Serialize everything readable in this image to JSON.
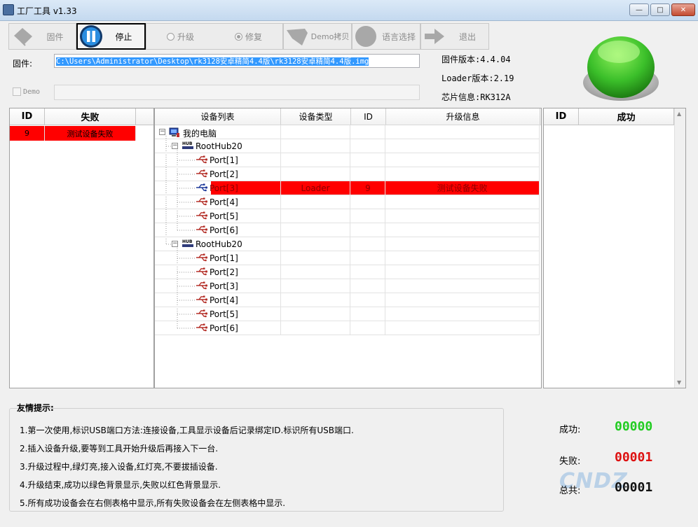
{
  "window": {
    "title": "工厂工具 v1.33",
    "buttons": [
      "minimize",
      "maximize",
      "close"
    ]
  },
  "toolbar": {
    "firmware_label": "固件",
    "stop_label": "停止",
    "upgrade_label": "升级",
    "repair_label": "修复",
    "demo_copy_label": "Demo拷贝",
    "language_label": "语言选择",
    "exit_label": "退出",
    "mode_selected": "修复"
  },
  "firmware": {
    "label": "固件:",
    "path": "C:\\Users\\Administrator\\Desktop\\rk3128安卓精简4.4版\\rk3128安卓精简4.4版.img"
  },
  "demo": {
    "label": "Demo",
    "checked": false,
    "value": ""
  },
  "info": {
    "fw_version": "固件版本:4.4.04",
    "loader_version": "Loader版本:2.19",
    "chip_info": "芯片信息:RK312A"
  },
  "status_light": {
    "color": "#2fb52f",
    "state": "green"
  },
  "fail_table": {
    "headers": [
      "ID",
      "失败"
    ],
    "rows": [
      {
        "id": "9",
        "msg": "测试设备失败"
      }
    ]
  },
  "success_table": {
    "headers": [
      "ID",
      "成功"
    ],
    "rows": []
  },
  "device_table": {
    "headers": [
      "设备列表",
      "设备类型",
      "ID",
      "升级信息"
    ],
    "tree": [
      {
        "label": "我的电脑",
        "icon": "computer-icon",
        "level": 0,
        "type": "",
        "id": "",
        "info": ""
      },
      {
        "label": "RootHub20",
        "icon": "hub-icon",
        "level": 1,
        "type": "",
        "id": "",
        "info": ""
      },
      {
        "label": "Port[1]",
        "icon": "usb-icon",
        "level": 2,
        "type": "",
        "id": "",
        "info": ""
      },
      {
        "label": "Port[2]",
        "icon": "usb-icon",
        "level": 2,
        "type": "",
        "id": "",
        "info": ""
      },
      {
        "label": "Port[3]",
        "icon": "usb-icon",
        "level": 2,
        "type": "Loader",
        "id": "9",
        "info": "测试设备失败",
        "failed": true
      },
      {
        "label": "Port[4]",
        "icon": "usb-icon",
        "level": 2,
        "type": "",
        "id": "",
        "info": ""
      },
      {
        "label": "Port[5]",
        "icon": "usb-icon",
        "level": 2,
        "type": "",
        "id": "",
        "info": ""
      },
      {
        "label": "Port[6]",
        "icon": "usb-icon",
        "level": 2,
        "type": "",
        "id": "",
        "info": ""
      },
      {
        "label": "RootHub20",
        "icon": "hub-icon",
        "level": 1,
        "type": "",
        "id": "",
        "info": ""
      },
      {
        "label": "Port[1]",
        "icon": "usb-icon",
        "level": 2,
        "type": "",
        "id": "",
        "info": ""
      },
      {
        "label": "Port[2]",
        "icon": "usb-icon",
        "level": 2,
        "type": "",
        "id": "",
        "info": ""
      },
      {
        "label": "Port[3]",
        "icon": "usb-icon",
        "level": 2,
        "type": "",
        "id": "",
        "info": ""
      },
      {
        "label": "Port[4]",
        "icon": "usb-icon",
        "level": 2,
        "type": "",
        "id": "",
        "info": ""
      },
      {
        "label": "Port[5]",
        "icon": "usb-icon",
        "level": 2,
        "type": "",
        "id": "",
        "info": ""
      },
      {
        "label": "Port[6]",
        "icon": "usb-icon",
        "level": 2,
        "type": "",
        "id": "",
        "info": ""
      }
    ],
    "hub_label": "HUB"
  },
  "tips": {
    "title": "友情提示:",
    "items": [
      "1.第一次使用,标识USB端口方法:连接设备,工具显示设备后记录绑定ID.标识所有USB端口.",
      "2.插入设备升级,要等到工具开始升级后再接入下一台.",
      "3.升级过程中,绿灯亮,接入设备,红灯亮,不要拔插设备.",
      "4.升级结束,成功以绿色背景显示,失败以红色背景显示.",
      "5.所有成功设备会在右侧表格中显示,所有失败设备会在左侧表格中显示."
    ]
  },
  "stats": {
    "success_label": "成功:",
    "success_value": "00000",
    "success_color": "#22cc22",
    "fail_label": "失败:",
    "fail_value": "00001",
    "fail_color": "#dd1111",
    "total_label": "总共:",
    "total_value": "00001",
    "total_color": "#111111"
  },
  "watermark": "CNDZ.com"
}
